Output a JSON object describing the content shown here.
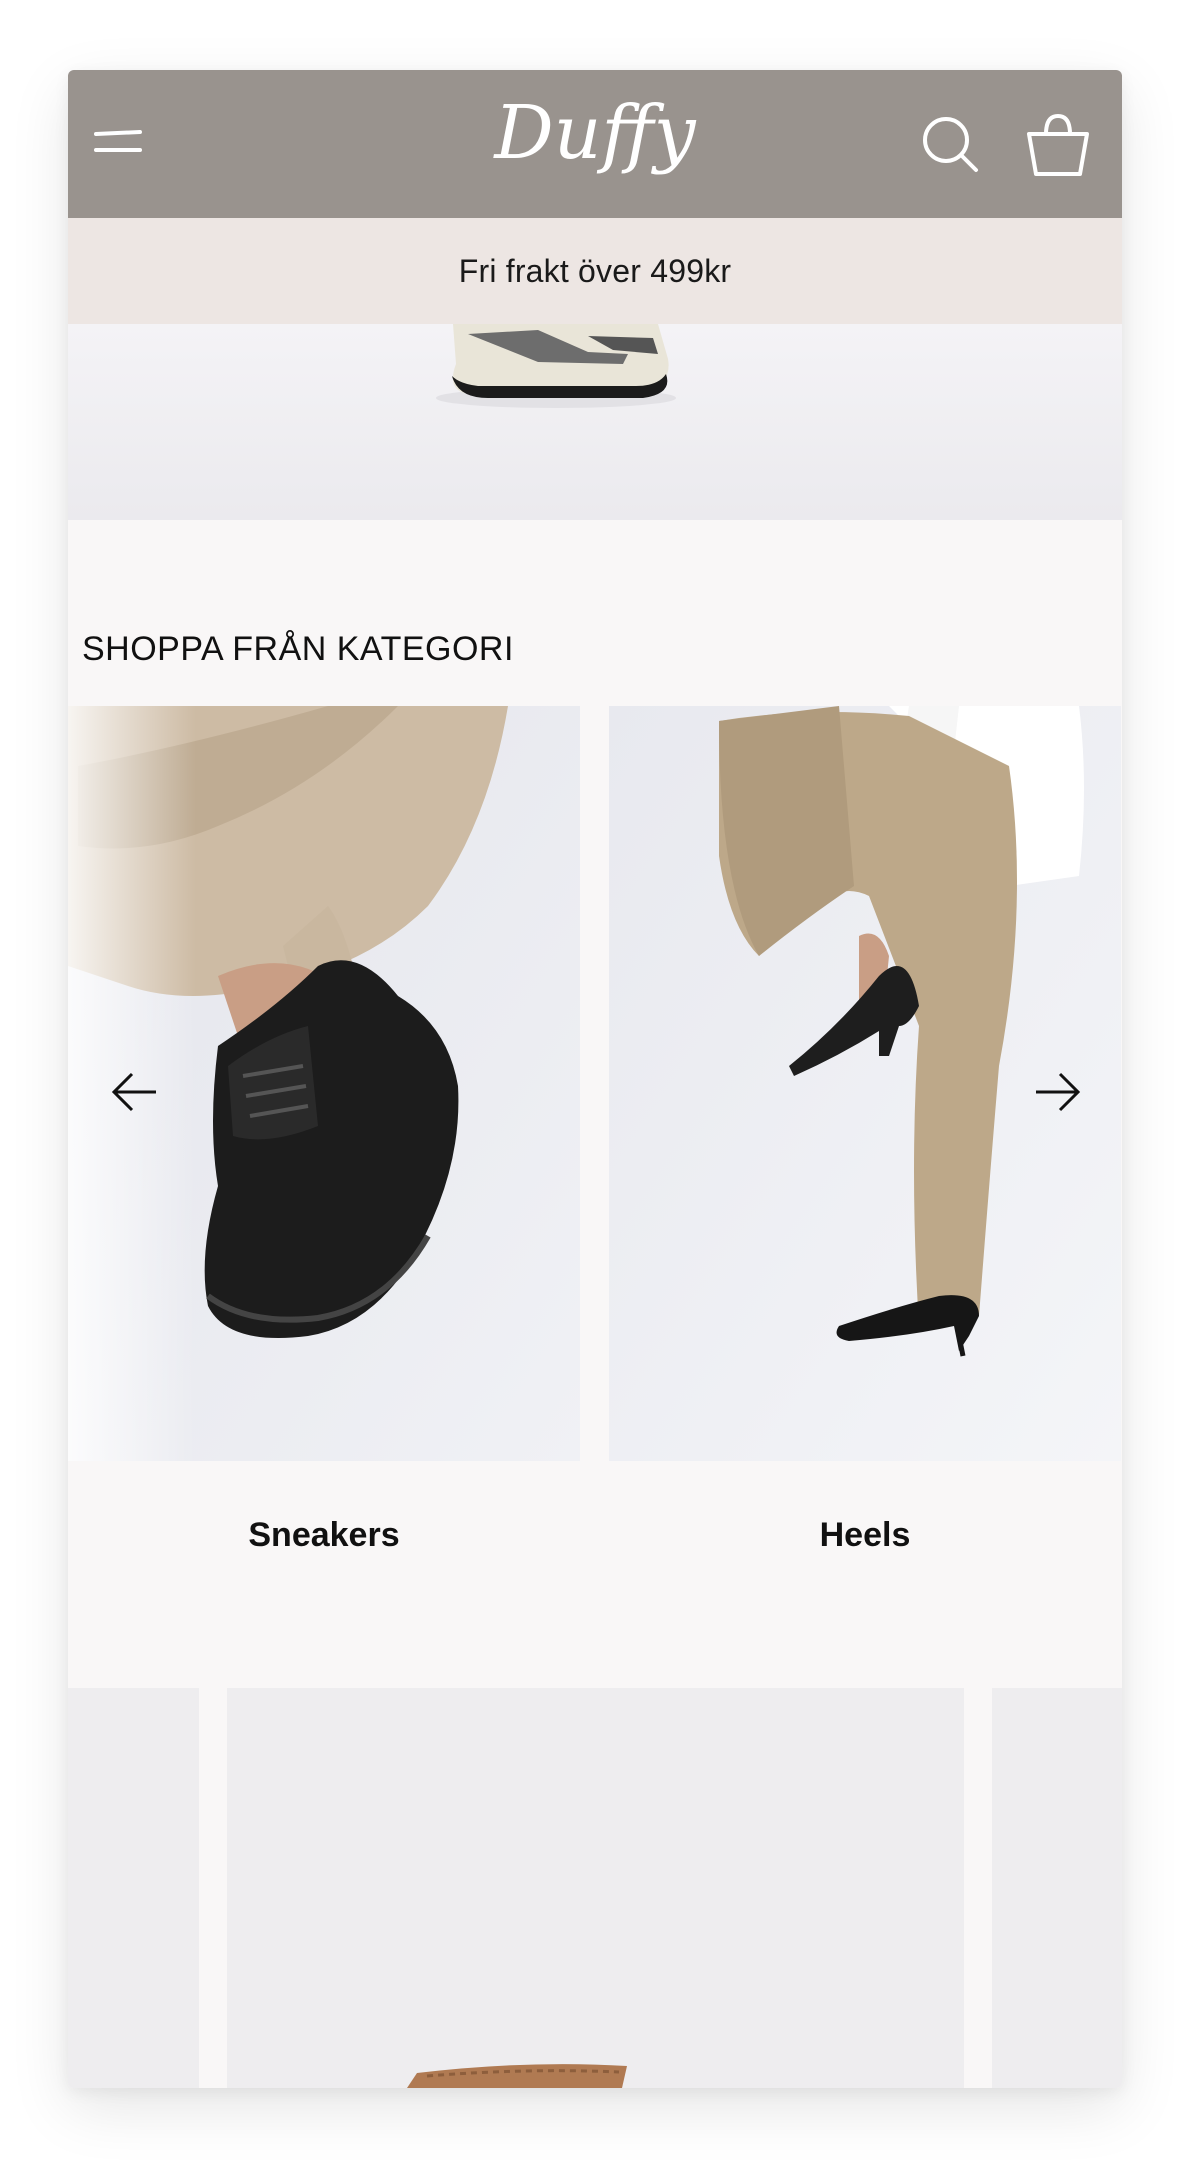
{
  "header": {
    "brand": "Duffy",
    "icons": [
      "menu-icon",
      "search-icon",
      "shopping-bag-icon"
    ],
    "background_color": "#99938e"
  },
  "announcement": {
    "text": "Fri frakt över 499kr",
    "background_color": "#ede6e3"
  },
  "categories_section": {
    "title": "SHOPPA FRÅN KATEGORI",
    "items": [
      {
        "label": "Sneakers"
      },
      {
        "label": "Heels"
      }
    ],
    "prev_icon": "arrow-left-icon",
    "next_icon": "arrow-right-icon"
  }
}
